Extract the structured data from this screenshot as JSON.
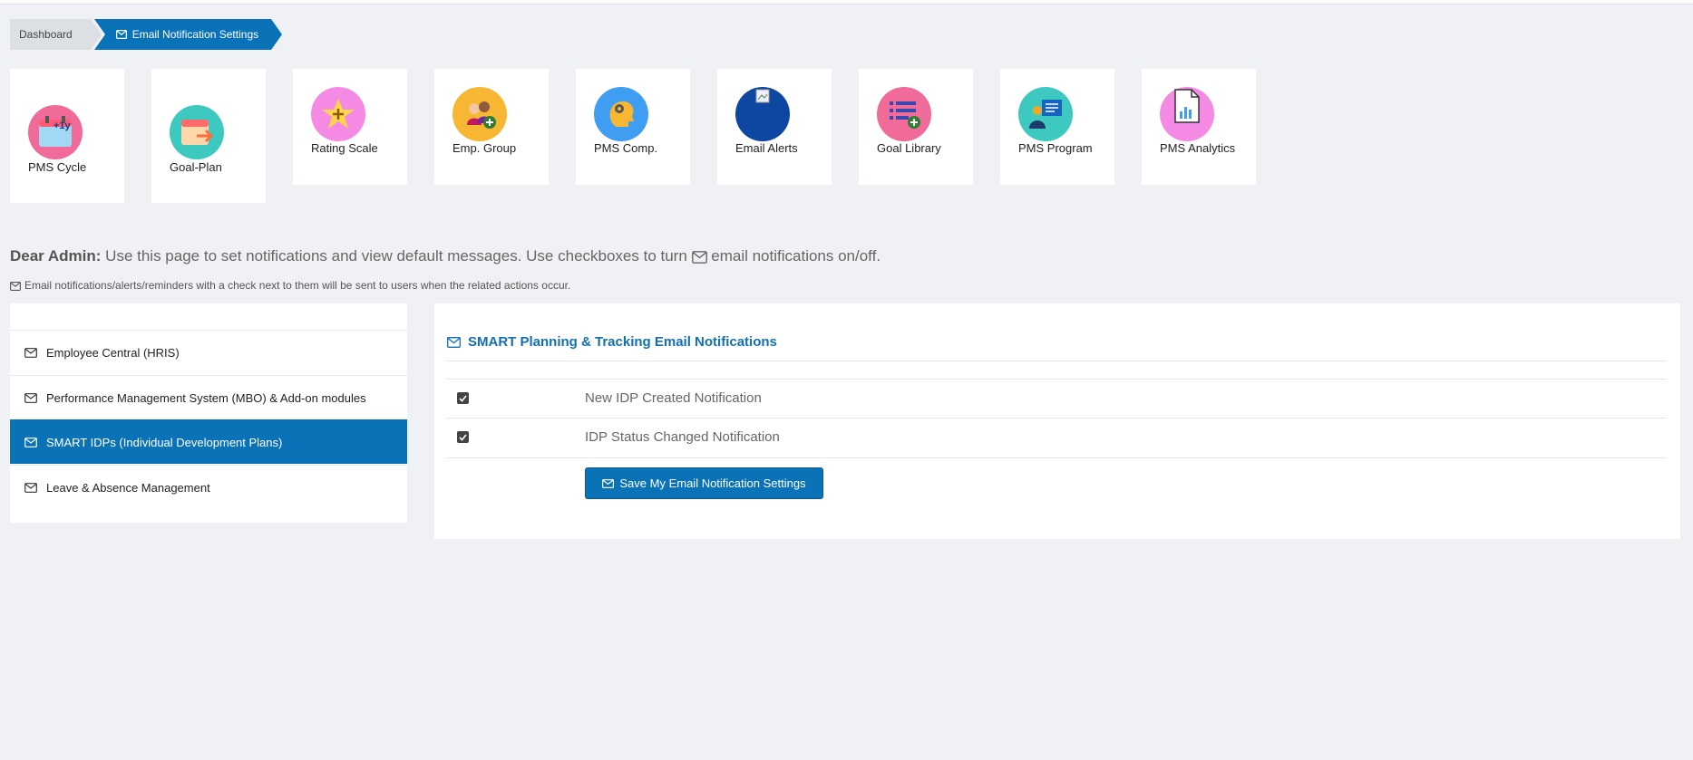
{
  "breadcrumb": {
    "home": "Dashboard",
    "current": "Email Notification Settings"
  },
  "tiles": [
    {
      "label": "PMS Cycle",
      "color": "#f06a9a",
      "icon": "calendar-plus-icon",
      "badge": "+1y"
    },
    {
      "label": "Goal-Plan",
      "color": "#3ec9c0",
      "icon": "calendar-arrow-icon"
    },
    {
      "label": "Rating Scale",
      "color": "#f58ae4",
      "icon": "star-icon"
    },
    {
      "label": "Emp. Group",
      "color": "#f7b733",
      "icon": "people-add-icon"
    },
    {
      "label": "PMS Comp.",
      "color": "#3f9df2",
      "icon": "head-gear-icon"
    },
    {
      "label": "Email Alerts",
      "color": "#0d47a1",
      "icon": "broken-image-icon"
    },
    {
      "label": "Goal Library",
      "color": "#f06a9a",
      "icon": "list-add-icon"
    },
    {
      "label": "PMS Program",
      "color": "#3ec9c0",
      "icon": "presenter-icon"
    },
    {
      "label": "PMS Analytics",
      "color": "#f58ae4",
      "icon": "document-chart-icon"
    }
  ],
  "message": {
    "greeting": "Dear Admin:",
    "text_before": " Use this page to set notifications and view default messages. Use checkboxes to turn ",
    "text_after": " email notifications on/off.",
    "note": "Email notifications/alerts/reminders with a check next to them will be sent to users when the related actions occur."
  },
  "menu": [
    {
      "label": "Employee Central (HRIS)",
      "active": false
    },
    {
      "label": "Performance Management System (MBO) & Add-on modules",
      "active": false
    },
    {
      "label": "SMART IDPs (Individual Development Plans)",
      "active": true
    },
    {
      "label": "Leave & Absence Management",
      "active": false
    }
  ],
  "panel": {
    "title": "SMART Planning & Tracking Email Notifications",
    "rows": [
      {
        "label": "New IDP Created Notification",
        "checked": true
      },
      {
        "label": "IDP Status Changed Notification",
        "checked": true
      }
    ],
    "save_label": "Save My Email Notification Settings"
  },
  "colors": {
    "accent": "#0a73b7",
    "background": "#f0f1f5"
  }
}
